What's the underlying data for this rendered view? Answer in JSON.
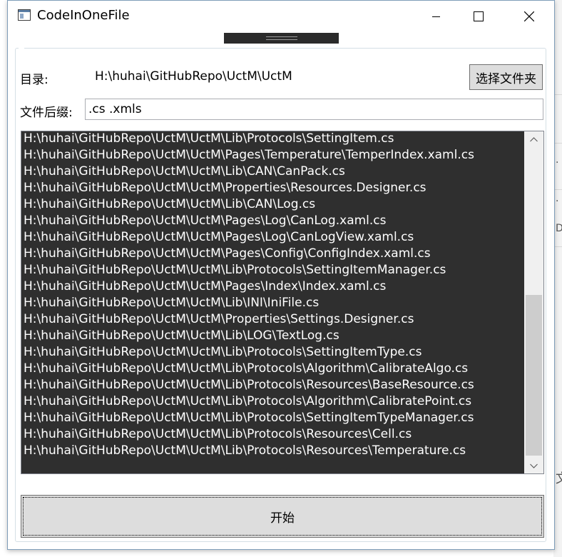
{
  "window": {
    "title": "CodeInOneFile",
    "controls": {
      "minimize": "minimize",
      "maximize": "maximize",
      "close": "close"
    }
  },
  "form": {
    "dir_label": "目录:",
    "dir_value": "H:\\huhai\\GitHubRepo\\UctM\\UctM",
    "choose_folder_label": "选择文件夹",
    "suffix_label": "文件后缀:",
    "suffix_value": ".cs .xmls",
    "start_label": "开始"
  },
  "file_list": [
    "H:\\huhai\\GitHubRepo\\UctM\\UctM\\Lib\\Protocols\\SettingItem.cs",
    "H:\\huhai\\GitHubRepo\\UctM\\UctM\\Pages\\Temperature\\TemperIndex.xaml.cs",
    "H:\\huhai\\GitHubRepo\\UctM\\UctM\\Lib\\CAN\\CanPack.cs",
    "H:\\huhai\\GitHubRepo\\UctM\\UctM\\Properties\\Resources.Designer.cs",
    "H:\\huhai\\GitHubRepo\\UctM\\UctM\\Lib\\CAN\\Log.cs",
    "H:\\huhai\\GitHubRepo\\UctM\\UctM\\Pages\\Log\\CanLog.xaml.cs",
    "H:\\huhai\\GitHubRepo\\UctM\\UctM\\Pages\\Log\\CanLogView.xaml.cs",
    "H:\\huhai\\GitHubRepo\\UctM\\UctM\\Pages\\Config\\ConfigIndex.xaml.cs",
    "H:\\huhai\\GitHubRepo\\UctM\\UctM\\Lib\\Protocols\\SettingItemManager.cs",
    "H:\\huhai\\GitHubRepo\\UctM\\UctM\\Pages\\Index\\Index.xaml.cs",
    "H:\\huhai\\GitHubRepo\\UctM\\UctM\\Lib\\INI\\IniFile.cs",
    "H:\\huhai\\GitHubRepo\\UctM\\UctM\\Properties\\Settings.Designer.cs",
    "H:\\huhai\\GitHubRepo\\UctM\\UctM\\Lib\\LOG\\TextLog.cs",
    "H:\\huhai\\GitHubRepo\\UctM\\UctM\\Lib\\Protocols\\SettingItemType.cs",
    "H:\\huhai\\GitHubRepo\\UctM\\UctM\\Lib\\Protocols\\Algorithm\\CalibrateAlgo.cs",
    "H:\\huhai\\GitHubRepo\\UctM\\UctM\\Lib\\Protocols\\Resources\\BaseResource.cs",
    "H:\\huhai\\GitHubRepo\\UctM\\UctM\\Lib\\Protocols\\Algorithm\\CalibratePoint.cs",
    "H:\\huhai\\GitHubRepo\\UctM\\UctM\\Lib\\Protocols\\SettingItemTypeManager.cs",
    "H:\\huhai\\GitHubRepo\\UctM\\UctM\\Lib\\Protocols\\Resources\\Cell.cs",
    "H:\\huhai\\GitHubRepo\\UctM\\UctM\\Lib\\Protocols\\Resources\\Temperature.cs"
  ],
  "scrollbar": {
    "position": 0.53
  },
  "background_window": {
    "fragments": [
      ".",
      ".",
      "D",
      "文"
    ]
  },
  "colors": {
    "list_background": "#2f2f2f",
    "list_text": "#ffffff",
    "button_face": "#dddddd",
    "scroll_thumb": "#cdcdcd"
  }
}
